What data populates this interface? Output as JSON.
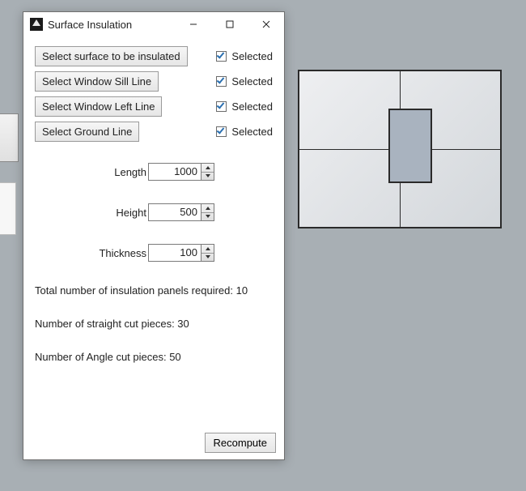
{
  "window": {
    "title": "Surface Insulation"
  },
  "select_rows": [
    {
      "button": "Select surface to be insulated",
      "checked": true,
      "status": "Selected"
    },
    {
      "button": "Select Window Sill Line",
      "checked": true,
      "status": "Selected"
    },
    {
      "button": "Select Window Left Line",
      "checked": true,
      "status": "Selected"
    },
    {
      "button": "Select Ground Line",
      "checked": true,
      "status": "Selected"
    }
  ],
  "inputs": {
    "length": {
      "label": "Length",
      "value": "1000"
    },
    "height": {
      "label": "Height",
      "value": "500"
    },
    "thickness": {
      "label": "Thickness",
      "value": "100"
    }
  },
  "results": {
    "total_panels": "Total number of insulation panels required: 10",
    "straight_pieces": "Number of straight cut pieces: 30",
    "angle_pieces": "Number of Angle cut pieces: 50"
  },
  "buttons": {
    "recompute": "Recompute"
  }
}
